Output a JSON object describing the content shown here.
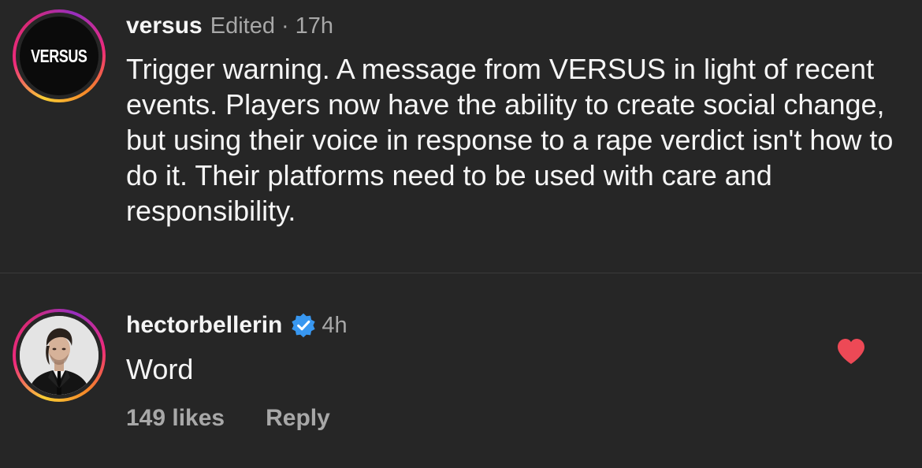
{
  "comments": [
    {
      "username": "versus",
      "edited": "Edited",
      "separator": "·",
      "time": "17h",
      "avatar_text": "VERSUS",
      "text": "Trigger warning. A message from VERSUS in light of recent events. Players now have the ability to create social change, but using their voice in response to a rape verdict isn't how to do it. Their platforms need to be used with care and responsibility."
    },
    {
      "username": "hectorbellerin",
      "verified_icon": "verified-badge-icon",
      "time": "4h",
      "text": "Word",
      "likes": "149 likes",
      "reply": "Reply",
      "liked": true,
      "like_icon": "heart-icon"
    }
  ],
  "colors": {
    "background": "#262626",
    "primary_text": "#f5f5f5",
    "secondary_text": "#a8a8a8",
    "verified_blue": "#3897f0",
    "heart_red": "#ed4956"
  }
}
